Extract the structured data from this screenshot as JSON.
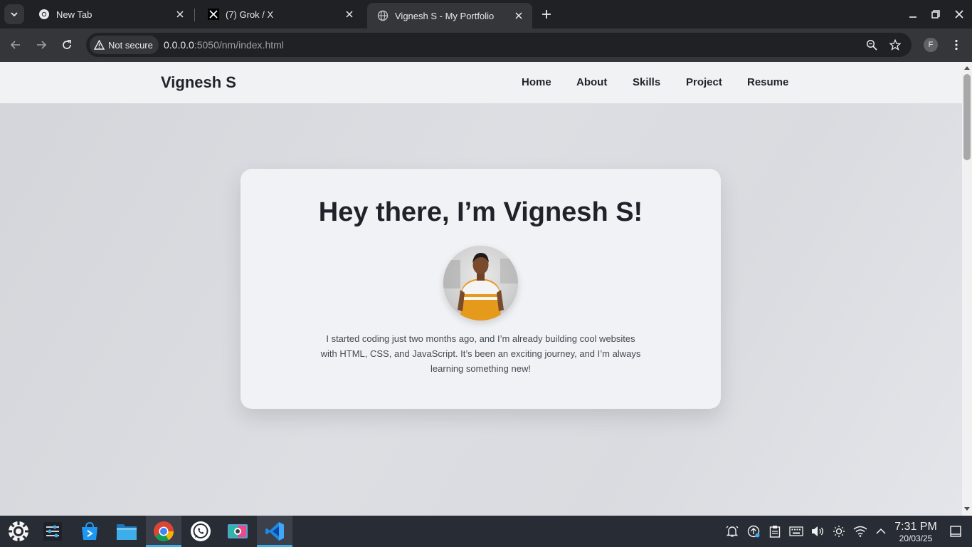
{
  "browser": {
    "tabs": [
      {
        "title": "New Tab",
        "icon": "chrome-icon",
        "active": false
      },
      {
        "title": "(7) Grok / X",
        "icon": "x-logo-icon",
        "active": false
      },
      {
        "title": "Vignesh S - My Portfolio",
        "icon": "globe-icon",
        "active": true
      }
    ],
    "security_label": "Not secure",
    "url_host": "0.0.0.0",
    "url_rest": ":5050/nm/index.html",
    "profile_initial": "F"
  },
  "site": {
    "brand": "Vignesh S",
    "nav": [
      "Home",
      "About",
      "Skills",
      "Project",
      "Resume"
    ],
    "hero": {
      "title": "Hey there, I’m Vignesh S!",
      "text": "I started coding just two months ago, and I’m already building cool websites with HTML, CSS, and JavaScript. It’s been an exciting journey, and I’m always learning something new!"
    }
  },
  "taskbar": {
    "apps": [
      "app-launcher-icon",
      "system-settings-icon",
      "store-icon",
      "file-manager-icon",
      "chrome-icon",
      "whatsapp-icon",
      "screenshot-icon",
      "vscode-icon"
    ],
    "tray": [
      "notifications-icon",
      "updates-icon",
      "clipboard-icon",
      "keyboard-icon",
      "volume-icon",
      "brightness-icon",
      "wifi-icon",
      "tray-expand-icon"
    ],
    "time": "7:31 PM",
    "date": "20/03/25"
  },
  "colors": {
    "accent": "#3daee9",
    "chrome_dark": "#202124",
    "taskbar": "#282c34"
  }
}
